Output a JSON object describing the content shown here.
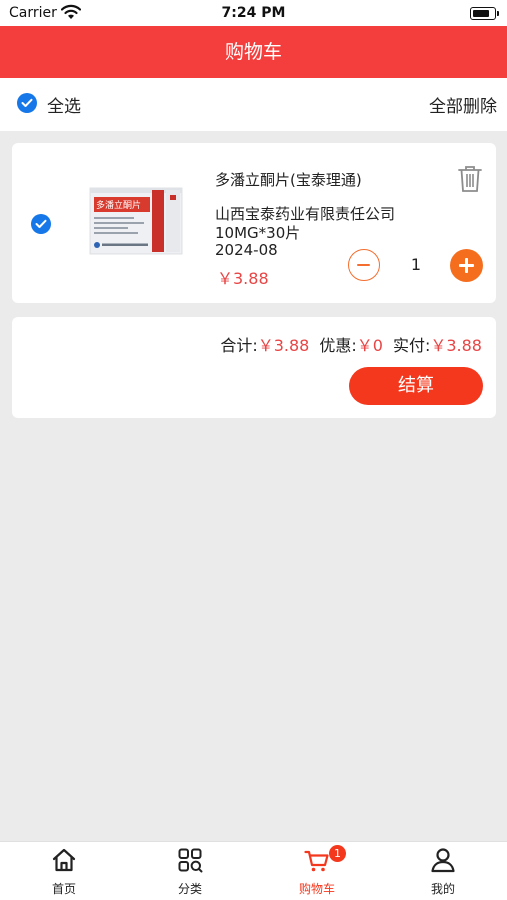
{
  "status_bar": {
    "carrier": "Carrier",
    "time": "7:24 PM"
  },
  "header": {
    "title": "购物车"
  },
  "select_bar": {
    "select_all_label": "全选",
    "delete_all_label": "全部删除",
    "select_all_checked": true
  },
  "cart_items": [
    {
      "checked": true,
      "name": "多潘立酮片(宝泰理通)",
      "manufacturer": "山西宝泰药业有限责任公司",
      "spec": "10MG*30片",
      "date": "2024-08",
      "price": "￥3.88",
      "quantity": "1",
      "image_box_label": "多潘立酮片"
    }
  ],
  "summary": {
    "total_label": "合计:",
    "total_value": "￥3.88",
    "discount_label": "优惠:",
    "discount_value": "￥0",
    "paid_label": "实付:",
    "paid_value": "￥3.88",
    "checkout_label": "结算"
  },
  "tabbar": {
    "tabs": [
      {
        "label": "首页",
        "icon": "home-icon",
        "active": false
      },
      {
        "label": "分类",
        "icon": "category-icon",
        "active": false
      },
      {
        "label": "购物车",
        "icon": "cart-icon",
        "active": true,
        "badge": "1"
      },
      {
        "label": "我的",
        "icon": "user-icon",
        "active": false
      }
    ]
  },
  "colors": {
    "header_bg": "#f43e3e",
    "accent_orange": "#f46e1e",
    "price_red": "#e84545",
    "checkbox_blue": "#1677e8",
    "checkout_red": "#f4381e",
    "page_bg": "#ebebeb"
  }
}
